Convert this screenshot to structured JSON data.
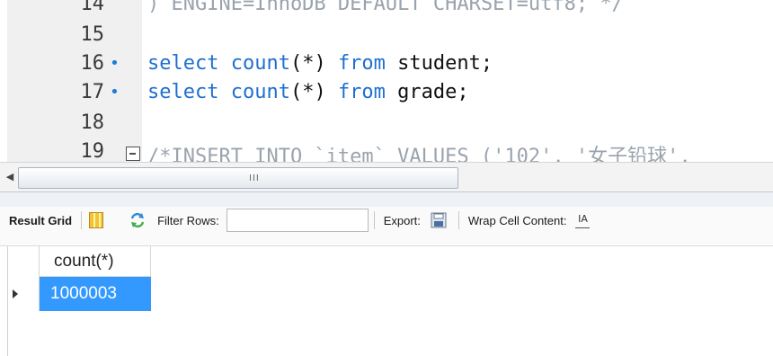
{
  "editor": {
    "lines": [
      {
        "num": "14",
        "marker": "",
        "tokens": [
          {
            "t": ") ENGINE=InnoDB DEFAULT CHARSET=utf8; */",
            "c": "cm"
          }
        ]
      },
      {
        "num": "15",
        "marker": "",
        "tokens": []
      },
      {
        "num": "16",
        "marker": "•",
        "tokens": [
          {
            "t": "select ",
            "c": "kw"
          },
          {
            "t": "count",
            "c": "kw"
          },
          {
            "t": "(*) ",
            "c": ""
          },
          {
            "t": "from ",
            "c": "kw"
          },
          {
            "t": "student;",
            "c": ""
          }
        ]
      },
      {
        "num": "17",
        "marker": "•",
        "tokens": [
          {
            "t": "select ",
            "c": "kw"
          },
          {
            "t": "count",
            "c": "kw"
          },
          {
            "t": "(*) ",
            "c": ""
          },
          {
            "t": "from ",
            "c": "kw"
          },
          {
            "t": "grade;",
            "c": ""
          }
        ]
      },
      {
        "num": "18",
        "marker": "",
        "tokens": []
      },
      {
        "num": "19",
        "marker": "",
        "fold": true,
        "tokens": [
          {
            "t": "/*INSERT INTO `item` VALUES ('102', '女子铅球', ",
            "c": "cm"
          }
        ]
      }
    ]
  },
  "scrollbar": {
    "left_arrow": "◀",
    "grip": "III"
  },
  "toolbar": {
    "result_grid_label": "Result Grid",
    "filter_label": "Filter Rows:",
    "filter_value": "",
    "export_label": "Export:",
    "wrap_label": "Wrap Cell Content:",
    "wrap_icon": "IA"
  },
  "grid": {
    "columns": [
      "count(*)"
    ],
    "rows": [
      [
        "1000003"
      ]
    ]
  },
  "colors": {
    "keyword": "#1f6fd1",
    "comment": "#9aa3ad",
    "selection": "#3399ff",
    "marker": "#1a7ed6"
  }
}
